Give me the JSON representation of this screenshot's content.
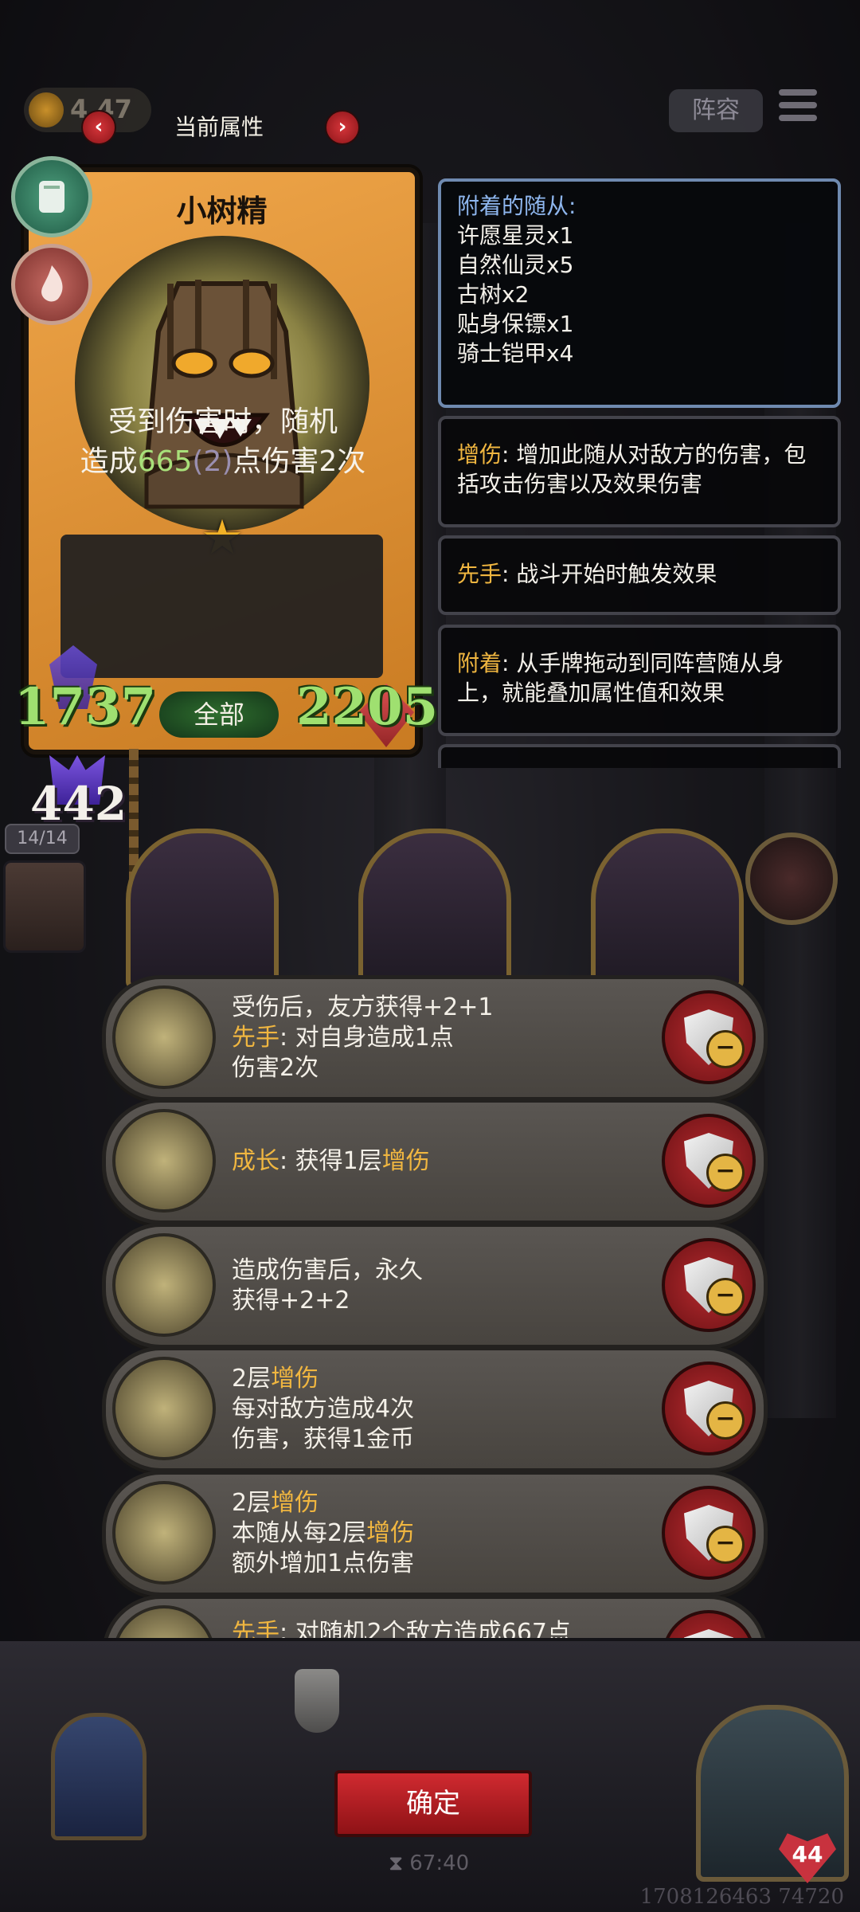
{
  "top": {
    "coin_value": "4 47",
    "attr_title": "当前属性",
    "nav_prev": "‹",
    "nav_next": "›",
    "lineup_label": "阵容"
  },
  "card": {
    "name": "小树精",
    "desc_line1": "受到伤害时，随机",
    "desc_prefix": "造成",
    "desc_damage": "665",
    "desc_paren": "(2)",
    "desc_suffix": "点伤害2次",
    "attack": "1737",
    "scope_label": "全部",
    "health": "2205",
    "armor": "442",
    "count_badge": "14/14"
  },
  "panels": {
    "attached_header": "附着的随从:",
    "attached": [
      "许愿星灵x1",
      "自然仙灵x5",
      "古树x2",
      "贴身保镖x1",
      "骑士铠甲x4"
    ],
    "dmg_key": "增伤",
    "dmg_text": ": 增加此随从对敌方的伤害，包括攻击伤害以及效果伤害",
    "first_key": "先手",
    "first_text": ": 战斗开始时触发效果",
    "attach_key": "附着",
    "attach_text": ": 从手牌拖动到同阵营随从身上，就能叠加属性值和效果"
  },
  "skills": [
    {
      "l1": "受伤后，友方获得+2+1",
      "l2_key": "先手",
      "l2": ": 对自身造成1点",
      "l3": "伤害2次"
    },
    {
      "l1_key": "成长",
      "l1_a": ": 获得1层",
      "l1_key2": "增伤"
    },
    {
      "l1": "造成伤害后，永久",
      "l2": "获得+2+2"
    },
    {
      "l1_a": "2层",
      "l1_key": "增伤",
      "l2": "每对敌方造成4次",
      "l3": "伤害，获得1金币"
    },
    {
      "l1_a": "2层",
      "l1_key": "增伤",
      "l2_a": "本随从每2层",
      "l2_key": "增伤",
      "l3": "额外增加1点伤害"
    },
    {
      "l1_key": "先手",
      "l1_a": ": 对随机2个敌方造成667",
      "l1_b": "点"
    }
  ],
  "remove_symbol": "−",
  "bottom": {
    "confirm_label": "确定",
    "timer": "67:40",
    "id_line": "1708126463 74720",
    "heart_value": "44"
  },
  "colors": {
    "highlight": "#f0b640",
    "stat_green": "#9fe070",
    "confirm_red": "#c81e24"
  }
}
